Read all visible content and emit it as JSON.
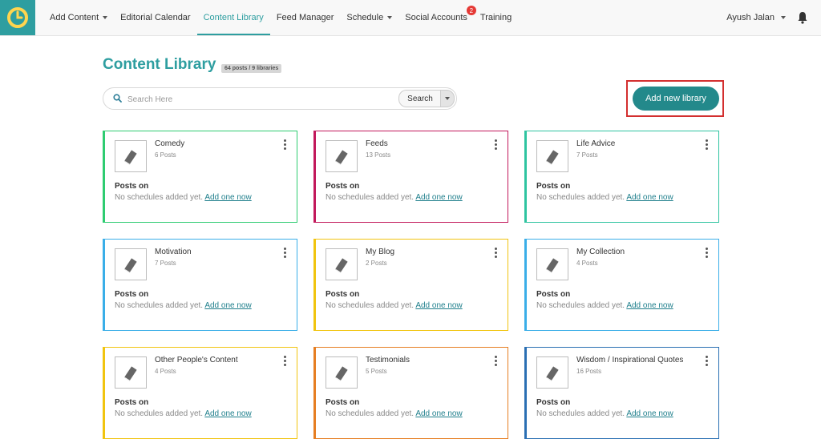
{
  "nav": {
    "items": [
      {
        "label": "Add Content",
        "dropdown": true
      },
      {
        "label": "Editorial Calendar"
      },
      {
        "label": "Content Library",
        "active": true
      },
      {
        "label": "Feed Manager"
      },
      {
        "label": "Schedule",
        "dropdown": true
      },
      {
        "label": "Social Accounts",
        "badge": "2"
      },
      {
        "label": "Training"
      }
    ],
    "user_name": "Ayush Jalan"
  },
  "page": {
    "title": "Content Library",
    "count_pill": "64 posts / 9 libraries"
  },
  "search": {
    "placeholder": "Search Here",
    "button_label": "Search"
  },
  "add_library_label": "Add new library",
  "card_common": {
    "posts_on_label": "Posts on",
    "no_schedules_text": "No schedules added yet.",
    "add_one_link": "Add one now"
  },
  "libraries": [
    {
      "name": "Comedy",
      "count": "6 Posts",
      "color": "#2ecc71"
    },
    {
      "name": "Feeds",
      "count": "13 Posts",
      "color": "#c2185b"
    },
    {
      "name": "Life Advice",
      "count": "7 Posts",
      "color": "#2ec4a0"
    },
    {
      "name": "Motivation",
      "count": "7 Posts",
      "color": "#3aaee8"
    },
    {
      "name": "My Blog",
      "count": "2 Posts",
      "color": "#f1c40f"
    },
    {
      "name": "My Collection",
      "count": "4 Posts",
      "color": "#3aaee8"
    },
    {
      "name": "Other People's Content",
      "count": "4 Posts",
      "color": "#f1c40f"
    },
    {
      "name": "Testimonials",
      "count": "5 Posts",
      "color": "#e67e22"
    },
    {
      "name": "Wisdom / Inspirational Quotes",
      "count": "16 Posts",
      "color": "#2a6fb3"
    }
  ],
  "colors": {
    "brand": "#2e9ea0",
    "button": "#23898b",
    "highlight": "#d32f2f",
    "badge": "#e53935"
  }
}
